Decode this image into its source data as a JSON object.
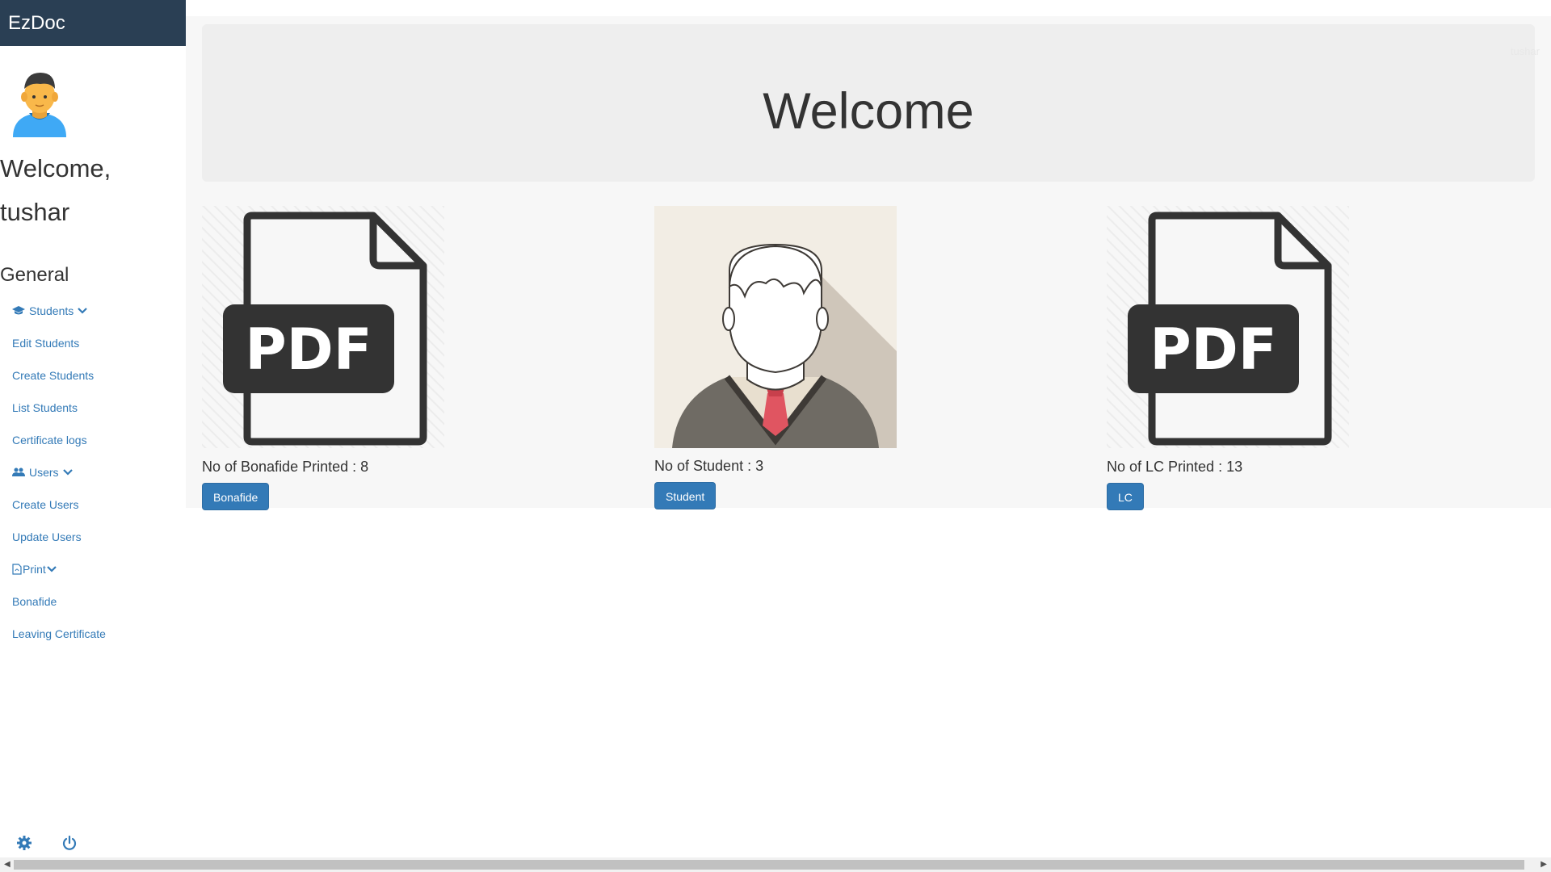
{
  "brand": "EzDoc",
  "sidebar": {
    "welcome_line1": "Welcome,",
    "welcome_line2": "tushar",
    "section_title": "General",
    "items": [
      {
        "label": "Students",
        "type": "header",
        "icon": "graduation-cap-icon"
      },
      {
        "label": "Edit Students"
      },
      {
        "label": "Create Students"
      },
      {
        "label": "List Students"
      },
      {
        "label": "Certificate logs"
      },
      {
        "label": "Users",
        "type": "header",
        "icon": "users-icon"
      },
      {
        "label": "Create Users"
      },
      {
        "label": "Update Users"
      },
      {
        "label": "Print",
        "type": "header",
        "icon": "pdf-file-icon"
      },
      {
        "label": "Bonafide"
      },
      {
        "label": "Leaving Certificate"
      }
    ],
    "footer_icons": [
      "gear-icon",
      "power-icon"
    ]
  },
  "header": {
    "user_menu": "tushar"
  },
  "jumbotron": {
    "title": "Welcome"
  },
  "cards": [
    {
      "stat": "No of Bonafide Printed : 8",
      "button": "Bonafide",
      "image": "pdf-document-icon"
    },
    {
      "stat": "No of Student : 3",
      "button": "Student",
      "image": "student-avatar-icon"
    },
    {
      "stat": "No of LC Printed : 13",
      "button": "LC",
      "image": "pdf-document-icon"
    }
  ],
  "colors": {
    "brand_bg": "#2a3f54",
    "link": "#337ab7",
    "button": "#337ab7",
    "jumbotron_bg": "#eeeeee"
  }
}
